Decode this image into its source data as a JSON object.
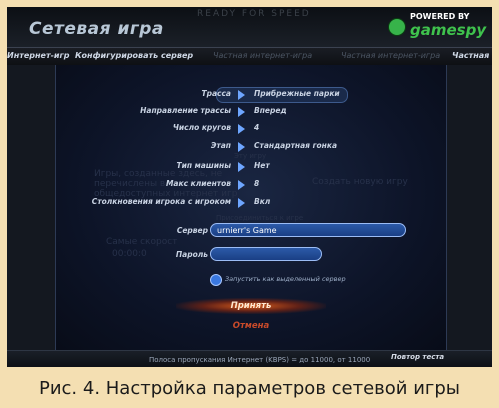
{
  "header": {
    "title": "Сетевая игра",
    "background_text": "READY FOR SPEED",
    "badge": {
      "powered_by": "POWERED BY",
      "brand": "gamespy"
    }
  },
  "tabs": [
    {
      "label": "Интернет-игр",
      "active": false
    },
    {
      "label": "Конфигурировать сервер",
      "active": true
    },
    {
      "label": "Частная интернет-игра",
      "active": false
    },
    {
      "label": "Частная интернет-игра",
      "active": false
    },
    {
      "label": "Частная ин",
      "active": false
    }
  ],
  "ghost_text": {
    "line1": "Игры, созданные здесь, не",
    "line2": "перечислены в списк",
    "line3": "общедоступных интернет игр",
    "fastest": "Самые скорост",
    "timer": "00:00:0",
    "right_btn": "Создать новую игру",
    "bottom_label": "Присоединиться к игре",
    "small": "Эту игру"
  },
  "settings": [
    {
      "label": "Трасса",
      "value": "Прибрежные парки",
      "highlight": true
    },
    {
      "label": "Направление трассы",
      "value": "Вперед"
    },
    {
      "label": "Число кругов",
      "value": "4"
    },
    {
      "label": "Этап",
      "value": "Стандартная гонка"
    },
    {
      "label": "Тип машины",
      "value": "Нет"
    },
    {
      "label": "Макс клиентов",
      "value": "8"
    },
    {
      "label": "Столкновения игрока с игроком",
      "value": "Вкл"
    }
  ],
  "server": {
    "label": "Сервер",
    "value": "urnierr's Game"
  },
  "password": {
    "label": "Пароль",
    "value": ""
  },
  "dedicated_label": "Запустить как выделенный сервер",
  "buttons": {
    "ok": "Принять",
    "cancel": "Отмена"
  },
  "footer": {
    "bandwidth": "Полоса пропускания Интернет (KBPS) = до 11000, от 11000",
    "retest": "Повтор теста"
  },
  "caption": "Рис. 4. Настройка параметров сетевой игры"
}
